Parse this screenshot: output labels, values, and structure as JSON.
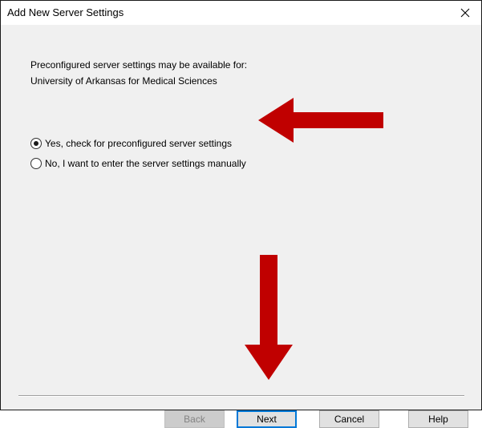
{
  "window": {
    "title": "Add New Server Settings",
    "close_glyph": "✕"
  },
  "intro": {
    "line1": "Preconfigured server settings may be available for:",
    "line2": "University of Arkansas for Medical Sciences"
  },
  "options": [
    {
      "label": "Yes, check for preconfigured server settings",
      "selected": true
    },
    {
      "label": "No, I want to enter the server settings manually",
      "selected": false
    }
  ],
  "buttons": {
    "back": {
      "label": "Back",
      "enabled": false
    },
    "next": {
      "label": "Next",
      "enabled": true,
      "default": true
    },
    "cancel": {
      "label": "Cancel",
      "enabled": true
    },
    "help": {
      "label": "Help",
      "enabled": true
    }
  },
  "annotations": {
    "arrow_color": "#c00000",
    "arrows": [
      "left-pointing arrow at yes-option",
      "down-pointing arrow at next-button"
    ]
  },
  "colors": {
    "dialog_bg": "#f0f0f0",
    "titlebar_bg": "#ffffff",
    "default_button_border": "#0078d7"
  }
}
